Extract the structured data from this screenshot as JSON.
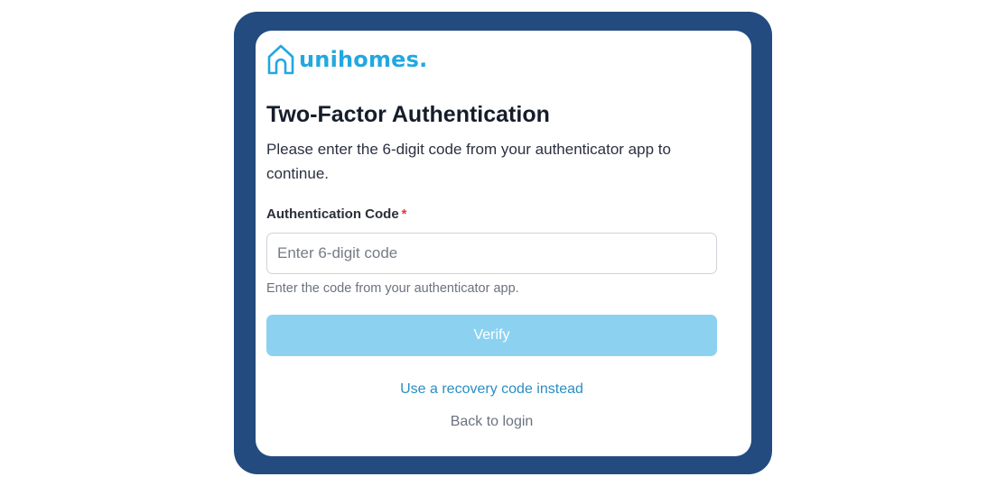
{
  "brand": {
    "name": "unihomes.",
    "icon": "house-outline-icon",
    "color": "#22a8e0"
  },
  "frame_color": "#234b80",
  "title": "Two-Factor Authentication",
  "subtitle": "Please enter the 6-digit code from your authenticator app to continue.",
  "form": {
    "label": "Authentication Code",
    "required_marker": "*",
    "input_value": "",
    "input_placeholder": "Enter 6-digit code",
    "helper_text": "Enter the code from your authenticator app."
  },
  "verify_button": {
    "label": "Verify",
    "color": "#8cd2f0"
  },
  "links": {
    "recovery": "Use a recovery code instead",
    "back_to_login": "Back to login"
  }
}
